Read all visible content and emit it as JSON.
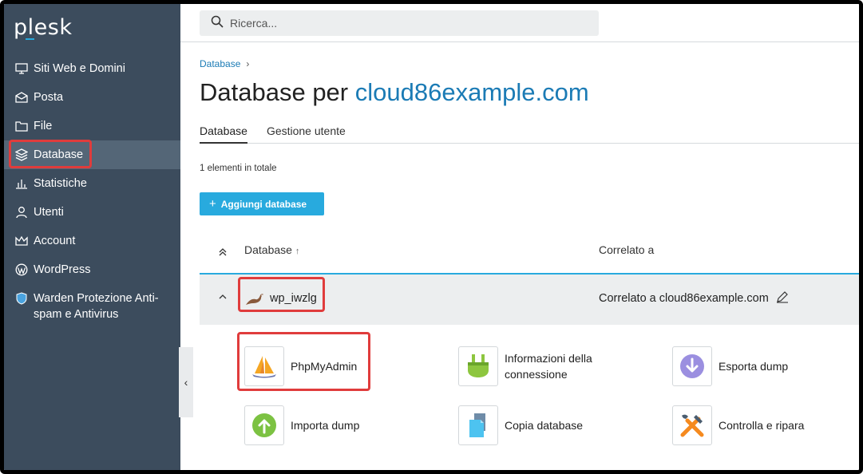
{
  "app": {
    "logo": "plesk"
  },
  "search": {
    "placeholder": "Ricerca..."
  },
  "sidebar": {
    "items": [
      {
        "label": "Siti Web e Domini",
        "icon": "monitor-icon"
      },
      {
        "label": "Posta",
        "icon": "mail-icon"
      },
      {
        "label": "File",
        "icon": "folder-icon"
      },
      {
        "label": "Database",
        "icon": "database-layers-icon",
        "active": true
      },
      {
        "label": "Statistiche",
        "icon": "bar-chart-icon"
      },
      {
        "label": "Utenti",
        "icon": "user-icon"
      },
      {
        "label": "Account",
        "icon": "crown-icon"
      },
      {
        "label": "WordPress",
        "icon": "wordpress-icon"
      },
      {
        "label": "Warden Protezione Anti-spam e Antivirus",
        "icon": "shield-icon"
      }
    ]
  },
  "breadcrumb": {
    "item": "Database",
    "separator": "›"
  },
  "page": {
    "title_prefix": "Database per",
    "title_domain": "cloud86example.com"
  },
  "tabs": [
    {
      "label": "Database",
      "active": true
    },
    {
      "label": "Gestione utente",
      "active": false
    }
  ],
  "list": {
    "count_text": "1 elementi in totale",
    "add_button": "Aggiungi database",
    "columns": {
      "database": "Database",
      "sort_arrow": "↑",
      "related": "Correlato a"
    },
    "rows": [
      {
        "name": "wp_iwzlg",
        "related": "Correlato a cloud86example.com"
      }
    ]
  },
  "tools": [
    {
      "label": "PhpMyAdmin",
      "icon": "phpmyadmin-sail-icon"
    },
    {
      "label": "Informazioni della connessione",
      "icon": "plug-icon"
    },
    {
      "label": "Esporta dump",
      "icon": "export-down-arrow-icon"
    },
    {
      "label": "Importa dump",
      "icon": "import-up-arrow-icon"
    },
    {
      "label": "Copia database",
      "icon": "copy-database-icon"
    },
    {
      "label": "Controlla e ripara",
      "icon": "wrench-hammer-icon"
    }
  ],
  "colors": {
    "sidebar": "#3c4c5d",
    "accent": "#28aade",
    "link": "#1b7bb5",
    "highlight": "#e03c3c"
  }
}
